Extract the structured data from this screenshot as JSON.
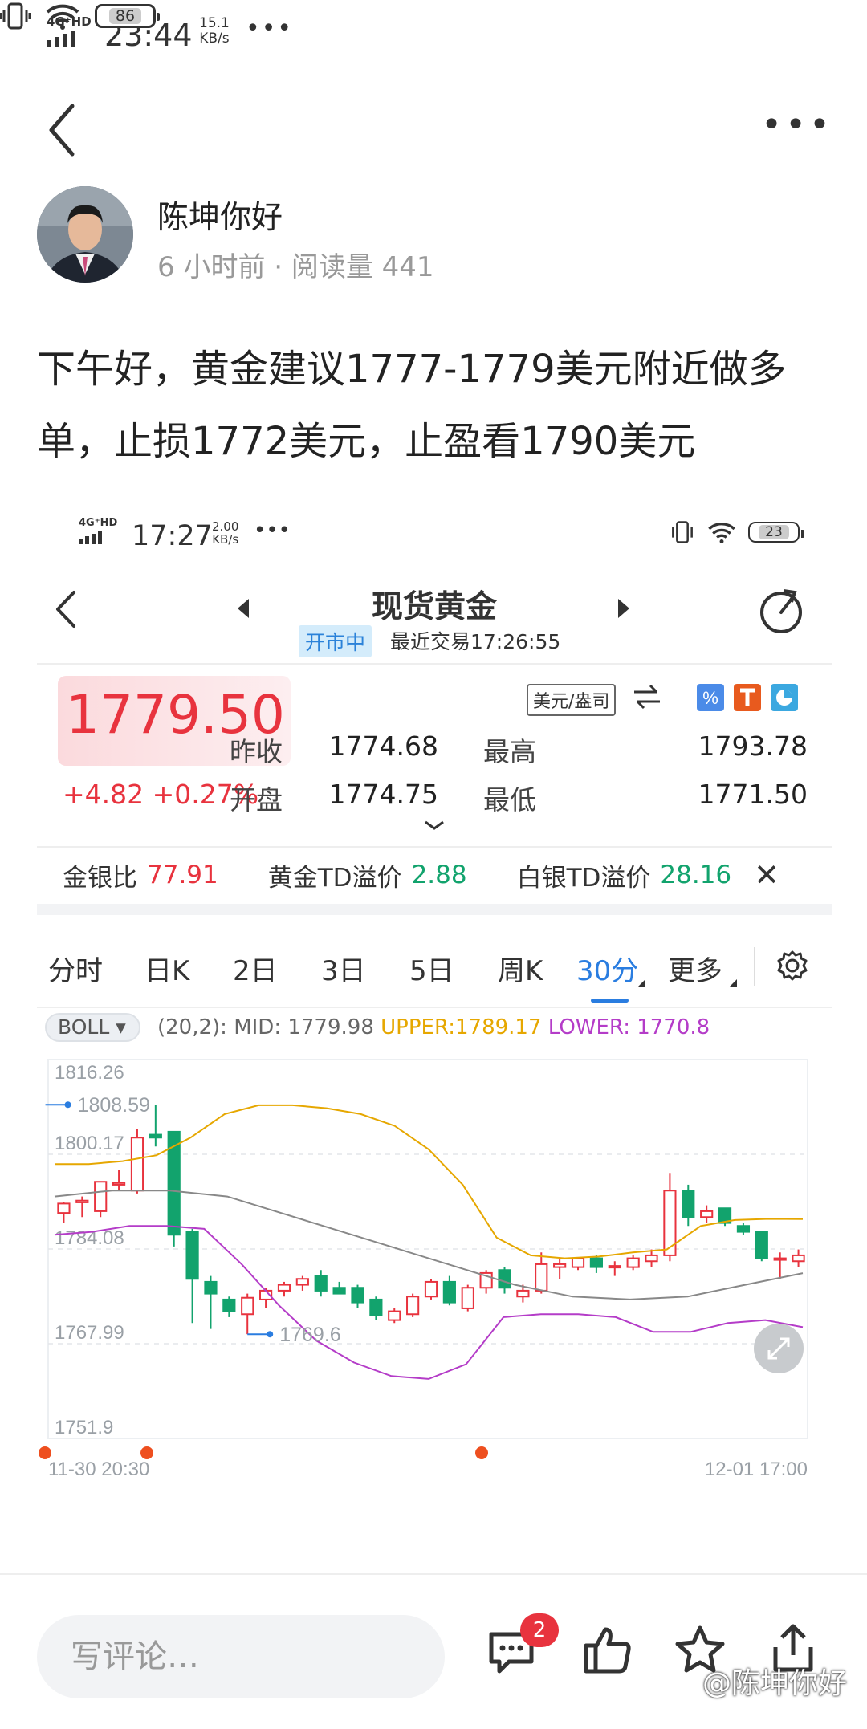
{
  "status_bar": {
    "network": "4G⁺HD",
    "time": "23:44",
    "speed_value": "15.1",
    "speed_unit": "KB/s",
    "more": "•••",
    "battery": "86"
  },
  "post": {
    "author": "陈坤你好",
    "meta": "6 小时前 · 阅读量 441",
    "text": "下午好，黄金建议1777-1779美元附近做多单，止损1772美元，止盈看1790美元"
  },
  "screenshot": {
    "status_bar": {
      "network": "4G⁺HD",
      "time": "17:27",
      "speed_value": "2.00",
      "speed_unit": "KB/s",
      "more": "•••",
      "battery": "23"
    },
    "title": "现货黄金",
    "trade_status": "开市中",
    "last_trade": "最近交易17:26:55",
    "price": "1779.50",
    "change": "+4.82 +0.27%",
    "unit": "美元/盎司",
    "quotes": [
      {
        "label": "昨收",
        "value": "1774.68"
      },
      {
        "label": "最高",
        "value": "1793.78"
      },
      {
        "label": "开盘",
        "value": "1774.75"
      },
      {
        "label": "最低",
        "value": "1771.50"
      }
    ],
    "ratios": [
      {
        "label": "金银比",
        "value": "77.91",
        "color": "#e8333e"
      },
      {
        "label": "黄金TD溢价",
        "value": "2.88",
        "color": "#12a36d"
      },
      {
        "label": "白银TD溢价",
        "value": "28.16",
        "color": "#12a36d"
      }
    ],
    "tabs": [
      "分时",
      "日K",
      "2日",
      "3日",
      "5日",
      "周K",
      "30分",
      "更多"
    ],
    "active_tab": "30分",
    "indicator": {
      "name": "BOLL",
      "params": "(20,2): MID: 1779.98",
      "upper": "UPPER:1789.17",
      "lower": "LOWER: 1770.8",
      "upper_color": "#e6a700",
      "lower_color": "#b43cc8"
    },
    "chart_data": {
      "type": "candlestick",
      "y_axis_labels": [
        "1816.26",
        "1800.17",
        "1784.08",
        "1767.99",
        "1751.9"
      ],
      "ylim": [
        1751.9,
        1816.26
      ],
      "x_labels": [
        "11-30 20:30",
        "12-01 17:00"
      ],
      "annotations": [
        {
          "label": "1808.59",
          "value": 1808.59
        },
        {
          "label": "1769.6",
          "value": 1769.6
        }
      ],
      "up_color": "#e8333e",
      "down_color": "#12a36d",
      "candles": [
        {
          "o": 1790.2,
          "h": 1792.0,
          "l": 1788.5,
          "c": 1791.8
        },
        {
          "o": 1792.0,
          "h": 1793.0,
          "l": 1789.5,
          "c": 1792.3
        },
        {
          "o": 1790.5,
          "h": 1795.5,
          "l": 1789.5,
          "c": 1795.5
        },
        {
          "o": 1795.0,
          "h": 1797.5,
          "l": 1794.0,
          "c": 1795.3
        },
        {
          "o": 1794.0,
          "h": 1804.5,
          "l": 1793.5,
          "c": 1803.0
        },
        {
          "o": 1803.5,
          "h": 1808.6,
          "l": 1801.5,
          "c": 1803.0
        },
        {
          "o": 1804.0,
          "h": 1804.0,
          "l": 1784.5,
          "c": 1786.5
        },
        {
          "o": 1787.0,
          "h": 1787.5,
          "l": 1771.5,
          "c": 1779.0
        },
        {
          "o": 1778.5,
          "h": 1779.5,
          "l": 1770.5,
          "c": 1776.5
        },
        {
          "o": 1775.5,
          "h": 1776.0,
          "l": 1772.5,
          "c": 1773.5
        },
        {
          "o": 1773.0,
          "h": 1776.5,
          "l": 1769.6,
          "c": 1775.8
        },
        {
          "o": 1775.5,
          "h": 1777.5,
          "l": 1774.0,
          "c": 1777.0
        },
        {
          "o": 1777.0,
          "h": 1778.5,
          "l": 1776.0,
          "c": 1778.0
        },
        {
          "o": 1778.0,
          "h": 1779.5,
          "l": 1777.0,
          "c": 1779.0
        },
        {
          "o": 1779.5,
          "h": 1780.5,
          "l": 1776.0,
          "c": 1777.0
        },
        {
          "o": 1777.5,
          "h": 1778.5,
          "l": 1776.5,
          "c": 1776.5
        },
        {
          "o": 1777.5,
          "h": 1778.0,
          "l": 1774.0,
          "c": 1775.0
        },
        {
          "o": 1775.5,
          "h": 1776.0,
          "l": 1772.0,
          "c": 1772.8
        },
        {
          "o": 1772.0,
          "h": 1774.0,
          "l": 1771.5,
          "c": 1773.5
        },
        {
          "o": 1773.0,
          "h": 1776.5,
          "l": 1772.5,
          "c": 1776.0
        },
        {
          "o": 1776.0,
          "h": 1779.0,
          "l": 1775.5,
          "c": 1778.5
        },
        {
          "o": 1778.5,
          "h": 1779.5,
          "l": 1774.5,
          "c": 1775.0
        },
        {
          "o": 1774.0,
          "h": 1778.0,
          "l": 1773.5,
          "c": 1777.5
        },
        {
          "o": 1777.5,
          "h": 1780.5,
          "l": 1776.5,
          "c": 1780.0
        },
        {
          "o": 1780.5,
          "h": 1781.0,
          "l": 1776.5,
          "c": 1777.5
        },
        {
          "o": 1776.0,
          "h": 1778.0,
          "l": 1775.0,
          "c": 1777.0
        },
        {
          "o": 1777.0,
          "h": 1783.5,
          "l": 1776.5,
          "c": 1781.5
        },
        {
          "o": 1781.0,
          "h": 1782.5,
          "l": 1779.0,
          "c": 1781.5
        },
        {
          "o": 1781.0,
          "h": 1782.5,
          "l": 1780.5,
          "c": 1782.5
        },
        {
          "o": 1782.5,
          "h": 1783.0,
          "l": 1780.0,
          "c": 1781.0
        },
        {
          "o": 1781.0,
          "h": 1782.0,
          "l": 1779.5,
          "c": 1781.2
        },
        {
          "o": 1781.0,
          "h": 1783.0,
          "l": 1780.5,
          "c": 1782.5
        },
        {
          "o": 1782.0,
          "h": 1784.0,
          "l": 1781.0,
          "c": 1783.0
        },
        {
          "o": 1783.0,
          "h": 1797.0,
          "l": 1782.0,
          "c": 1794.0
        },
        {
          "o": 1794.0,
          "h": 1795.0,
          "l": 1788.0,
          "c": 1789.5
        },
        {
          "o": 1789.5,
          "h": 1791.5,
          "l": 1788.5,
          "c": 1790.5
        },
        {
          "o": 1791.0,
          "h": 1791.0,
          "l": 1788.0,
          "c": 1788.5
        },
        {
          "o": 1788.0,
          "h": 1788.5,
          "l": 1786.5,
          "c": 1787.0
        },
        {
          "o": 1787.0,
          "h": 1787.0,
          "l": 1782.0,
          "c": 1782.5
        },
        {
          "o": 1782.5,
          "h": 1783.5,
          "l": 1779.0,
          "c": 1782.5
        },
        {
          "o": 1782.0,
          "h": 1784.0,
          "l": 1781.0,
          "c": 1783.0
        }
      ],
      "upper_band": [
        1798.5,
        1798.5,
        1799,
        1800,
        1803,
        1807,
        1808.5,
        1808.5,
        1808,
        1807,
        1805,
        1801,
        1795,
        1786,
        1783,
        1782.5,
        1782.8,
        1783.5,
        1784,
        1788,
        1789,
        1789.2,
        1789.17
      ],
      "mid_band": [
        1793,
        1794,
        1794,
        1793,
        1790,
        1787,
        1784,
        1781,
        1778,
        1776,
        1775.5,
        1776,
        1778,
        1779.98
      ],
      "lower_band": [
        1786.5,
        1787,
        1788,
        1788,
        1787.5,
        1781.5,
        1774.5,
        1768.5,
        1764.8,
        1762.5,
        1762,
        1764.5,
        1772.5,
        1773,
        1773,
        1772.5,
        1770,
        1770,
        1771.5,
        1772,
        1770.8
      ]
    },
    "cancel": "✕"
  },
  "bottom_bar": {
    "comment_placeholder": "写评论…",
    "comment_count": "2",
    "watermark": "@陈坤你好"
  }
}
